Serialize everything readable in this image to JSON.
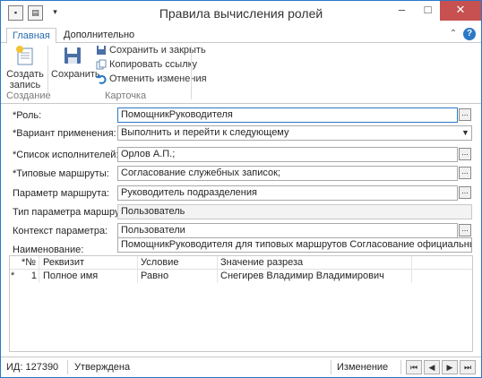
{
  "window": {
    "title": "Правила вычисления ролей",
    "colors": {
      "accent": "#2b78c5",
      "close": "#c75050",
      "selected_field": "#2b78c5"
    },
    "controls": {
      "minimize": "–",
      "maximize": "□",
      "close": "✕"
    },
    "system_icons": [
      "save-icon",
      "window-icon",
      "dropdown-icon"
    ]
  },
  "ribbon": {
    "tabs": [
      {
        "label": "Главная",
        "active": true
      },
      {
        "label": "Дополнительно",
        "active": false
      }
    ],
    "collapse_glyph": "⌃",
    "help_glyph": "?",
    "create_button": "Создать\nзапись",
    "create_group": "Создание",
    "save_button": "Сохранить",
    "save_close": "Сохранить и закрыть",
    "copy_link": "Копировать ссылку",
    "undo": "Отменить изменения",
    "card_group": "Карточка"
  },
  "form": {
    "role": {
      "label": "*Роль:",
      "value": "ПомощникРуководителя"
    },
    "variant": {
      "label": "*Вариант применения:",
      "value": "Выполнить  и перейти к следующему"
    },
    "performers": {
      "label": "*Список исполнителей:",
      "value": "Орлов А.П.;"
    },
    "routes": {
      "label": "*Типовые маршруты:",
      "value": "Согласование служебных записок;"
    },
    "route_param": {
      "label": "Параметр маршрута:",
      "value": "Руководитель подразделения"
    },
    "route_param_type": {
      "label": "Тип параметра маршрута:",
      "value": "Пользователь"
    },
    "param_context": {
      "label": "Контекст параметра:",
      "value": "Пользователи"
    },
    "name": {
      "label": "Наименование:",
      "value": "ПомощникРуководителя для типовых маршрутов Согласование официальных документов"
    }
  },
  "table": {
    "headers": [
      "*№",
      "Реквизит",
      "Условие",
      "Значение разреза"
    ],
    "rows": [
      {
        "marker": "*",
        "num": "1",
        "field": "Полное имя",
        "condition": "Равно",
        "value": "Снегирев Владимир Владимирович"
      }
    ]
  },
  "status": {
    "id": "ИД: 127390",
    "state": "Утверждена",
    "mode": "Изменение",
    "nav": {
      "first": "⏮",
      "prev": "◀",
      "next": "▶",
      "last": "⏭"
    }
  }
}
